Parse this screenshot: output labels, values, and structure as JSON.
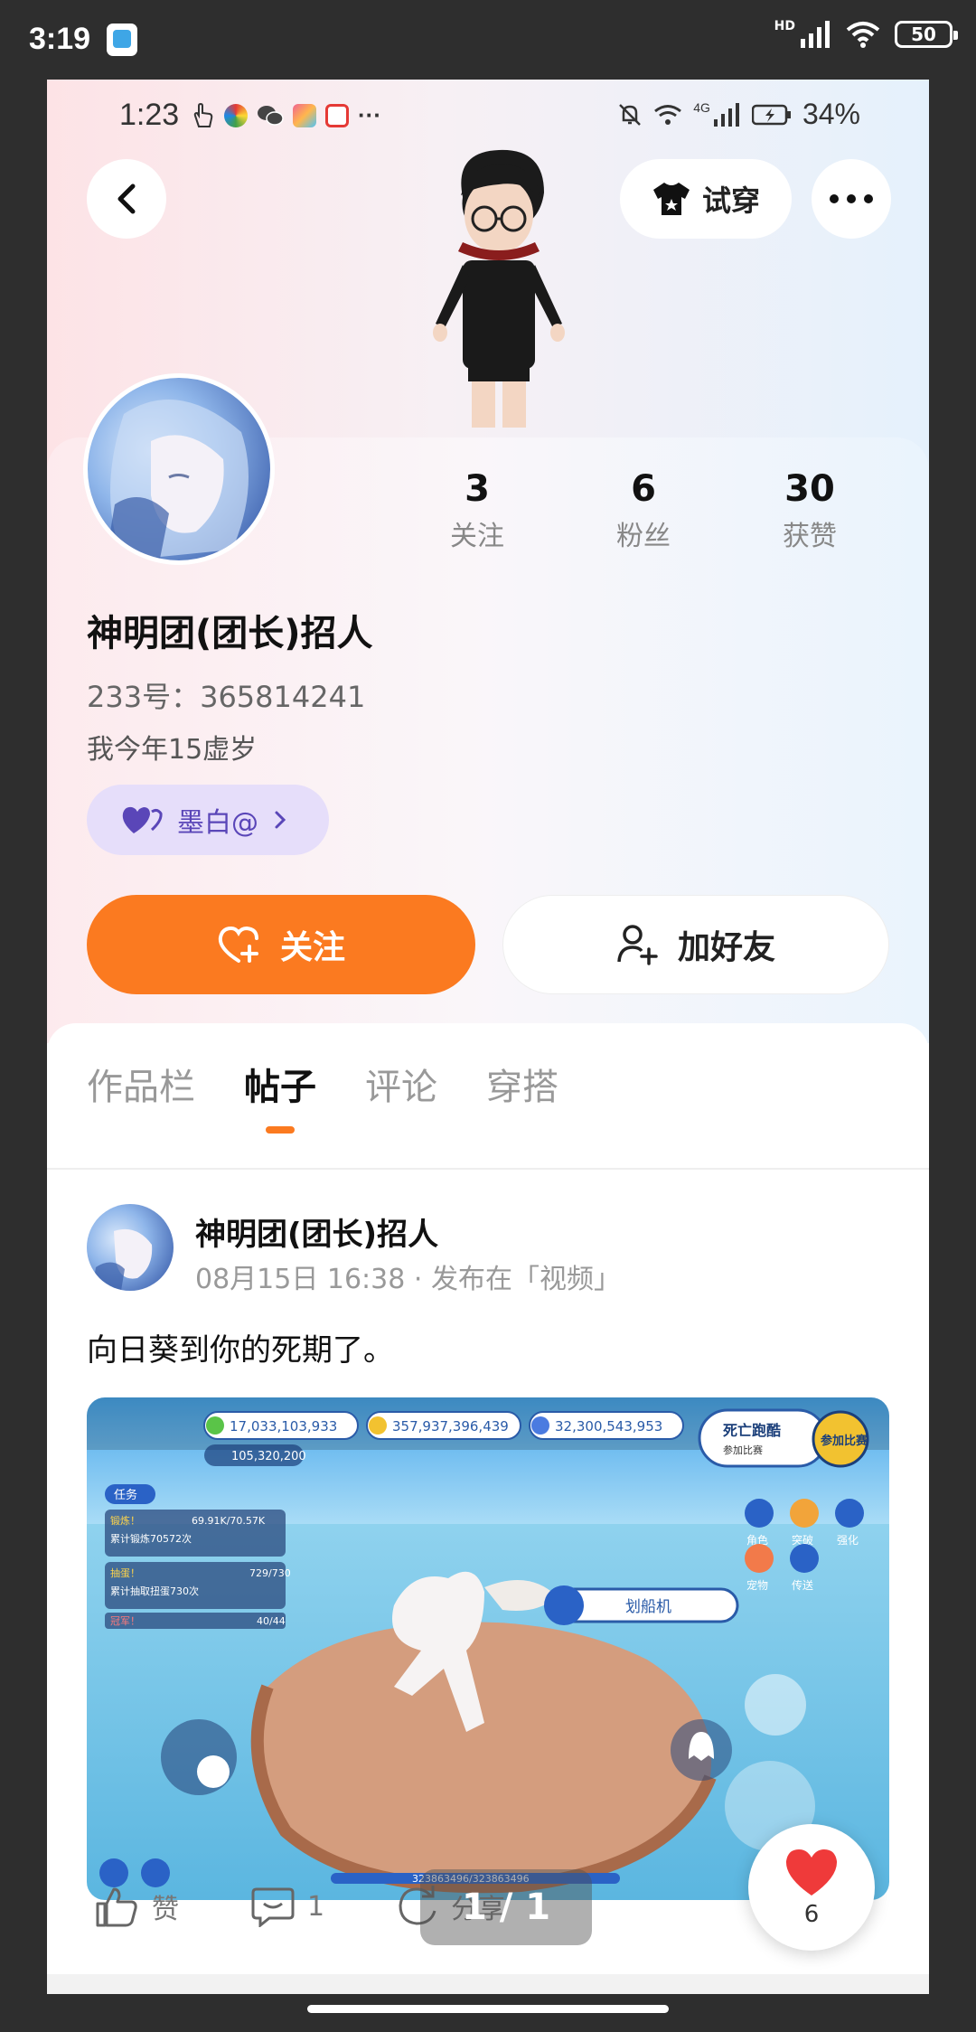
{
  "outer_status": {
    "time": "3:19",
    "network": "HD",
    "battery": "50"
  },
  "inner_status": {
    "time": "1:23",
    "dots": "···",
    "net_label": "4G",
    "battery": "34%"
  },
  "header": {
    "tryon_label": "试穿"
  },
  "stats": [
    {
      "value": "3",
      "label": "关注"
    },
    {
      "value": "6",
      "label": "粉丝"
    },
    {
      "value": "30",
      "label": "获赞"
    }
  ],
  "profile": {
    "username": "神明团(团长)招人",
    "id_line": "233号：365814241",
    "bio": "我今年15虚岁",
    "tag_label": "墨白@"
  },
  "actions": {
    "follow_label": "关注",
    "add_friend_label": "加好友"
  },
  "tabs": [
    {
      "label": "作品栏",
      "active": false
    },
    {
      "label": "帖子",
      "active": true
    },
    {
      "label": "评论",
      "active": false
    },
    {
      "label": "穿搭",
      "active": false
    }
  ],
  "post": {
    "author": "神明团(团长)招人",
    "meta": "08月15日 16:38 · 发布在「视频」",
    "text": "向日葵到你的死期了。",
    "page_indicator": "1 / 1",
    "like_float_count": "6",
    "like_label": "赞",
    "comment_count": "1",
    "share_label": "分享",
    "game": {
      "currency1": "17,033,103,933",
      "currency2": "357,937,396,439",
      "currency3": "32,300,543,953",
      "sub_currency": "105,320,200",
      "task_tab": "任务",
      "task1_title": "锻炼！",
      "task1_progress": "69.91K/70.57K",
      "task1_desc": "累计锻炼70572次",
      "task2_title": "抽蛋！",
      "task2_progress": "729/730",
      "task2_desc": "累计抽取扭蛋730次",
      "task3_title": "冠军！",
      "task3_progress": "40/44",
      "event_title": "死亡跑酷",
      "event_sub": "参加比赛",
      "event_badge": "参加比赛",
      "vehicle_label": "划船机",
      "btn_role": "角色",
      "btn_break": "突破",
      "btn_enhance": "强化",
      "btn_pet": "宠物",
      "btn_teleport": "传送",
      "hp": "323863496/323863496"
    }
  },
  "colors": {
    "accent": "#fb7a20",
    "tag_bg": "#e6defa",
    "tag_text": "#5a46b8",
    "heart": "#ef3a3a"
  }
}
